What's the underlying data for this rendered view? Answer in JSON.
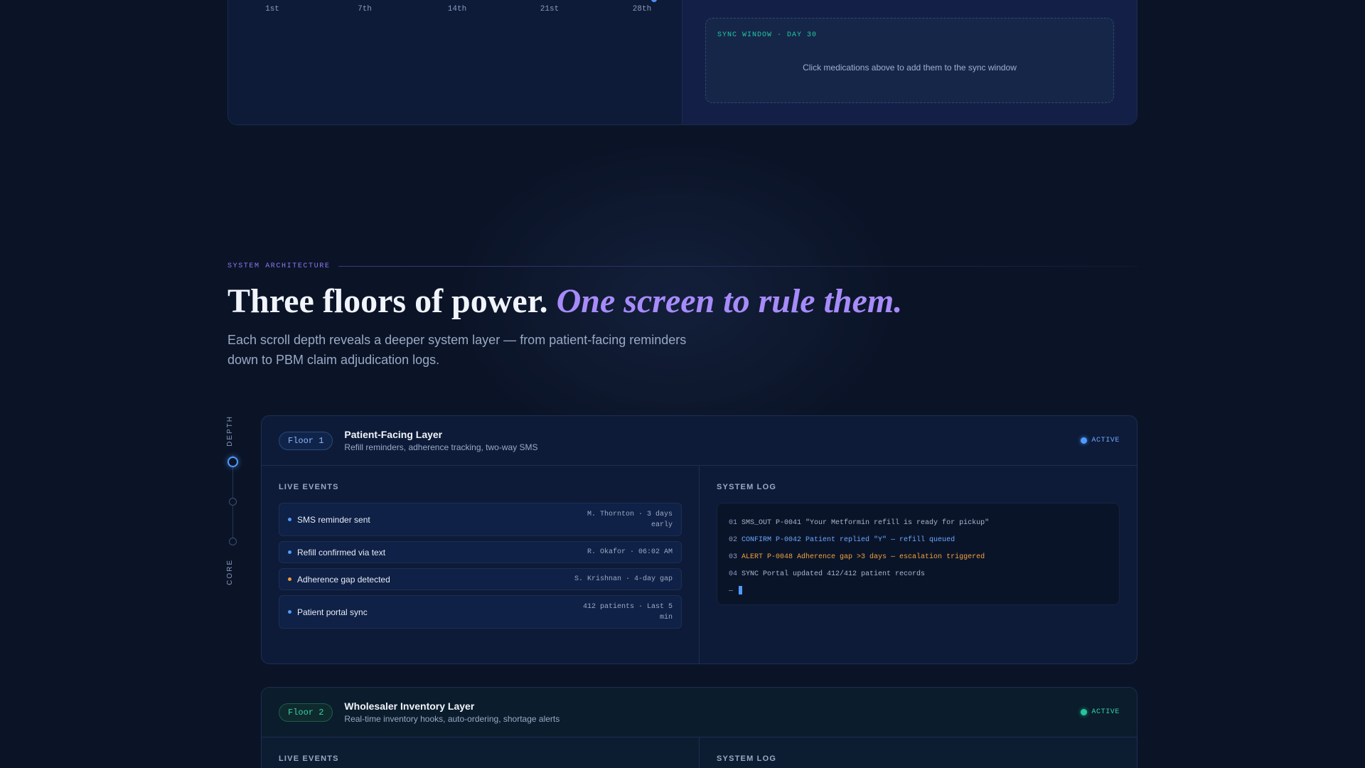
{
  "calendar": {
    "day_labels": [
      "1st",
      "7th",
      "14th",
      "21st",
      "28th"
    ],
    "sync_window_label": "SYNC WINDOW · DAY 30",
    "sync_hint": "Click medications above to add them to the sync window"
  },
  "architecture": {
    "eyebrow": "SYSTEM ARCHITECTURE",
    "headline_main": "Three floors of power.",
    "headline_accent": "One screen to rule them.",
    "subhead": "Each scroll depth reveals a deeper system layer — from patient-facing reminders down to PBM claim adjudication logs."
  },
  "depth_rail": {
    "top_label": "DEPTH",
    "bottom_label": "CORE"
  },
  "floors": [
    {
      "badge": "Floor 1",
      "title": "Patient-Facing Layer",
      "description": "Refill reminders, adherence tracking, two-way SMS",
      "status": "ACTIVE",
      "live_events_label": "LIVE EVENTS",
      "system_log_label": "SYSTEM LOG",
      "events": [
        {
          "name": "SMS reminder sent",
          "meta": "M. Thornton · 3 days early",
          "tone": "info"
        },
        {
          "name": "Refill confirmed via text",
          "meta": "R. Okafor · 06:02 AM",
          "tone": "info"
        },
        {
          "name": "Adherence gap detected",
          "meta": "S. Krishnan · 4-day gap",
          "tone": "warn"
        },
        {
          "name": "Patient portal sync",
          "meta": "412 patients · Last 5 min",
          "tone": "info"
        }
      ],
      "log": [
        {
          "num": "01",
          "msg": "SMS_OUT P-0041 \"Your Metformin refill is ready for pickup\"",
          "tone": "normal"
        },
        {
          "num": "02",
          "msg": "CONFIRM P-0042 Patient replied \"Y\" — refill queued",
          "tone": "confirm"
        },
        {
          "num": "03",
          "msg": "ALERT P-0048 Adherence gap >3 days — escalation triggered",
          "tone": "alert"
        },
        {
          "num": "04",
          "msg": "SYNC Portal updated 412/412 patient records",
          "tone": "normal"
        }
      ],
      "cursor_prefix": "—"
    },
    {
      "badge": "Floor 2",
      "title": "Wholesaler Inventory Layer",
      "description": "Real-time inventory hooks, auto-ordering, shortage alerts",
      "status": "ACTIVE",
      "live_events_label": "LIVE EVENTS",
      "system_log_label": "SYSTEM LOG"
    }
  ],
  "colors": {
    "background": "#0b1427",
    "accent_purple": "#a78bfa",
    "accent_blue": "#4f9bff",
    "accent_teal": "#22c79b",
    "alert_orange": "#f2a33a"
  }
}
